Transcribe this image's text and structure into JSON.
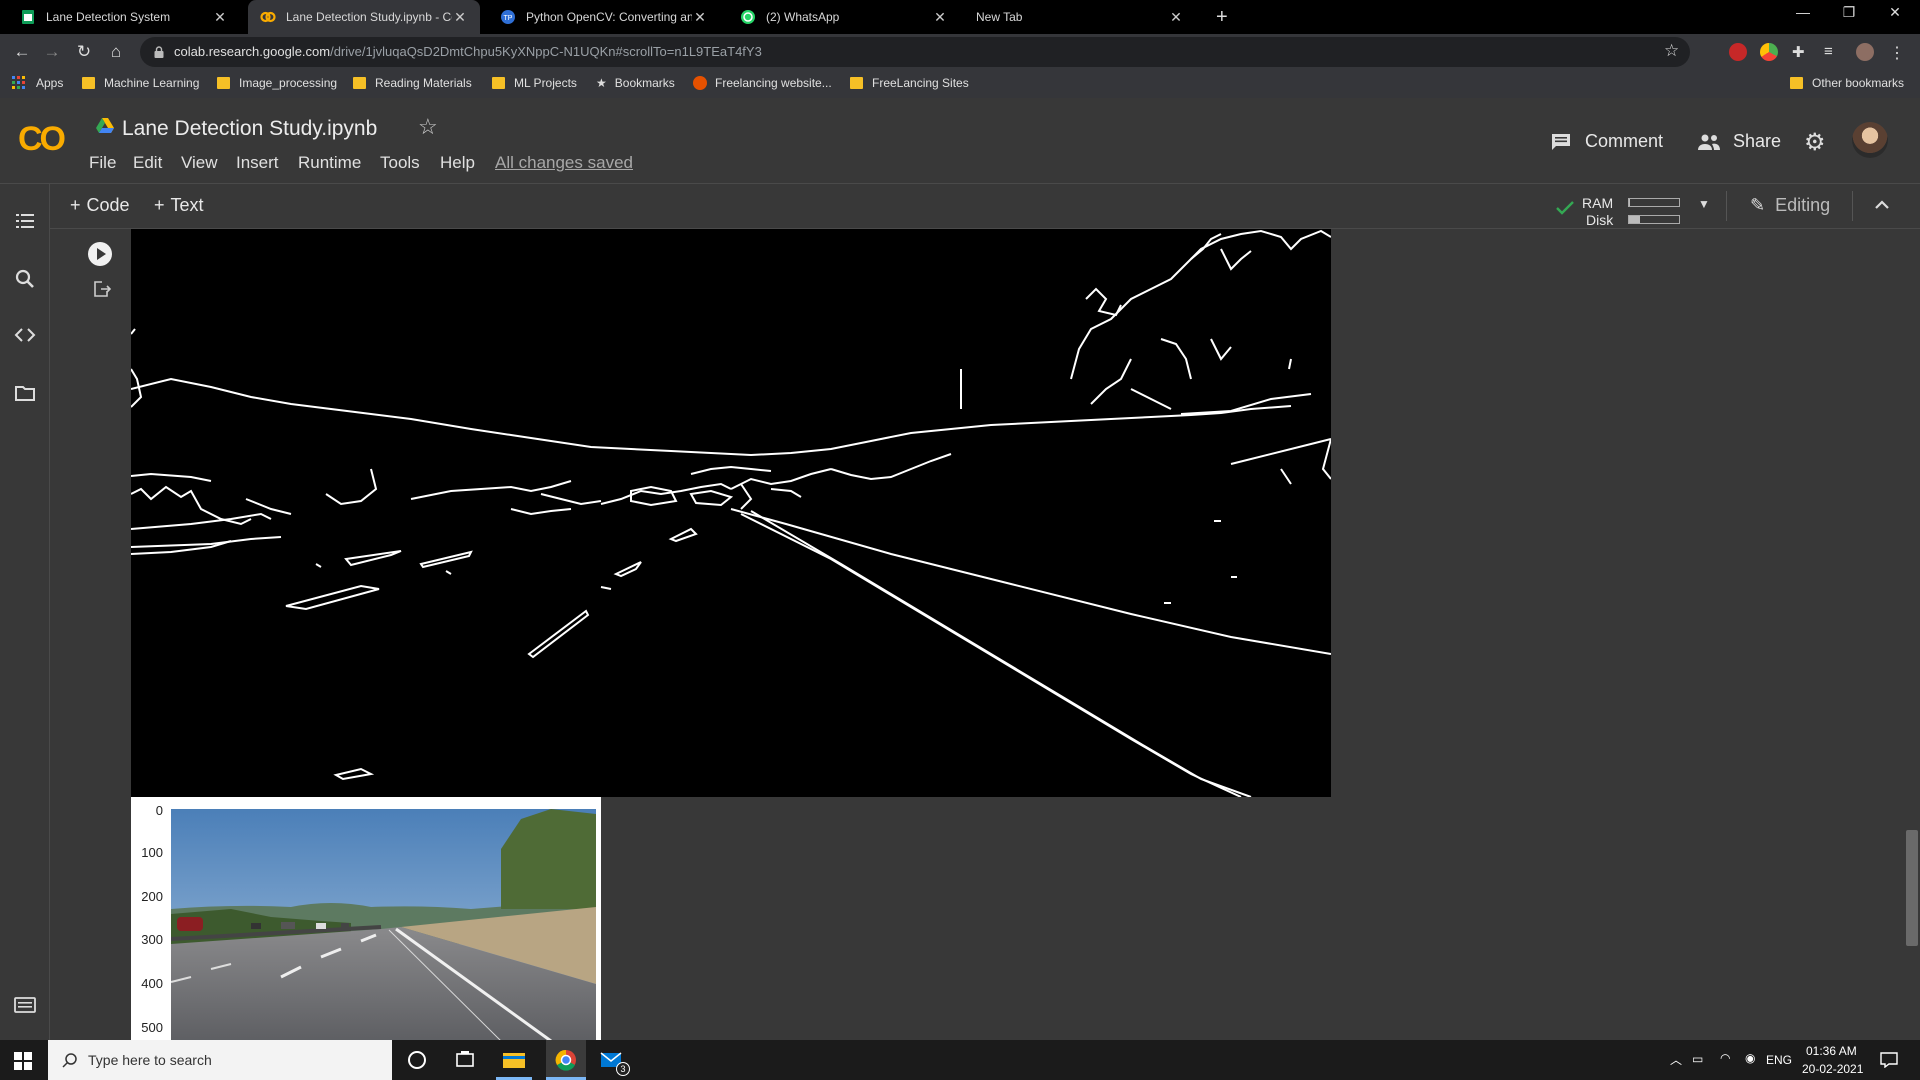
{
  "browser": {
    "tabs": [
      {
        "title": "Lane Detection System",
        "active": false
      },
      {
        "title": "Lane Detection Study.ipynb - Col",
        "active": true
      },
      {
        "title": "Python OpenCV: Converting an i",
        "active": false
      },
      {
        "title": "(2) WhatsApp",
        "active": false
      },
      {
        "title": "New Tab",
        "active": false
      }
    ],
    "url_host": "colab.research.google.com",
    "url_path": "/drive/1jvluqaQsD2DmtChpu5KyXNppC-N1UQKn#scrollTo=n1L9TEaT4fY3",
    "bookmarks": [
      "Apps",
      "Machine Learning",
      "Image_processing",
      "Reading Materials",
      "ML Projects",
      "Bookmarks",
      "Freelancing website...",
      "FreeLancing Sites"
    ],
    "other_bookmarks": "Other bookmarks"
  },
  "colab": {
    "logo": "CO",
    "notebook_title": "Lane Detection Study.ipynb",
    "menu": [
      "File",
      "Edit",
      "View",
      "Insert",
      "Runtime",
      "Tools",
      "Help"
    ],
    "save_status": "All changes saved",
    "comment_label": "Comment",
    "share_label": "Share",
    "toolbar": {
      "code_label": "Code",
      "text_label": "Text",
      "ram_label": "RAM",
      "disk_label": "Disk",
      "editing_label": "Editing"
    },
    "resources": {
      "ram_fraction": 0.02,
      "disk_fraction": 0.22
    }
  },
  "output": {
    "y_ticks": [
      "0",
      "100",
      "200",
      "300",
      "400",
      "500"
    ]
  },
  "taskbar": {
    "search_placeholder": "Type here to search",
    "mail_badge": "3",
    "language": "ENG",
    "time": "01:36 AM",
    "date": "20-02-2021"
  },
  "colors": {
    "colab_orange": "#f9ab00",
    "background": "#383838",
    "check_green": "#34a853"
  }
}
